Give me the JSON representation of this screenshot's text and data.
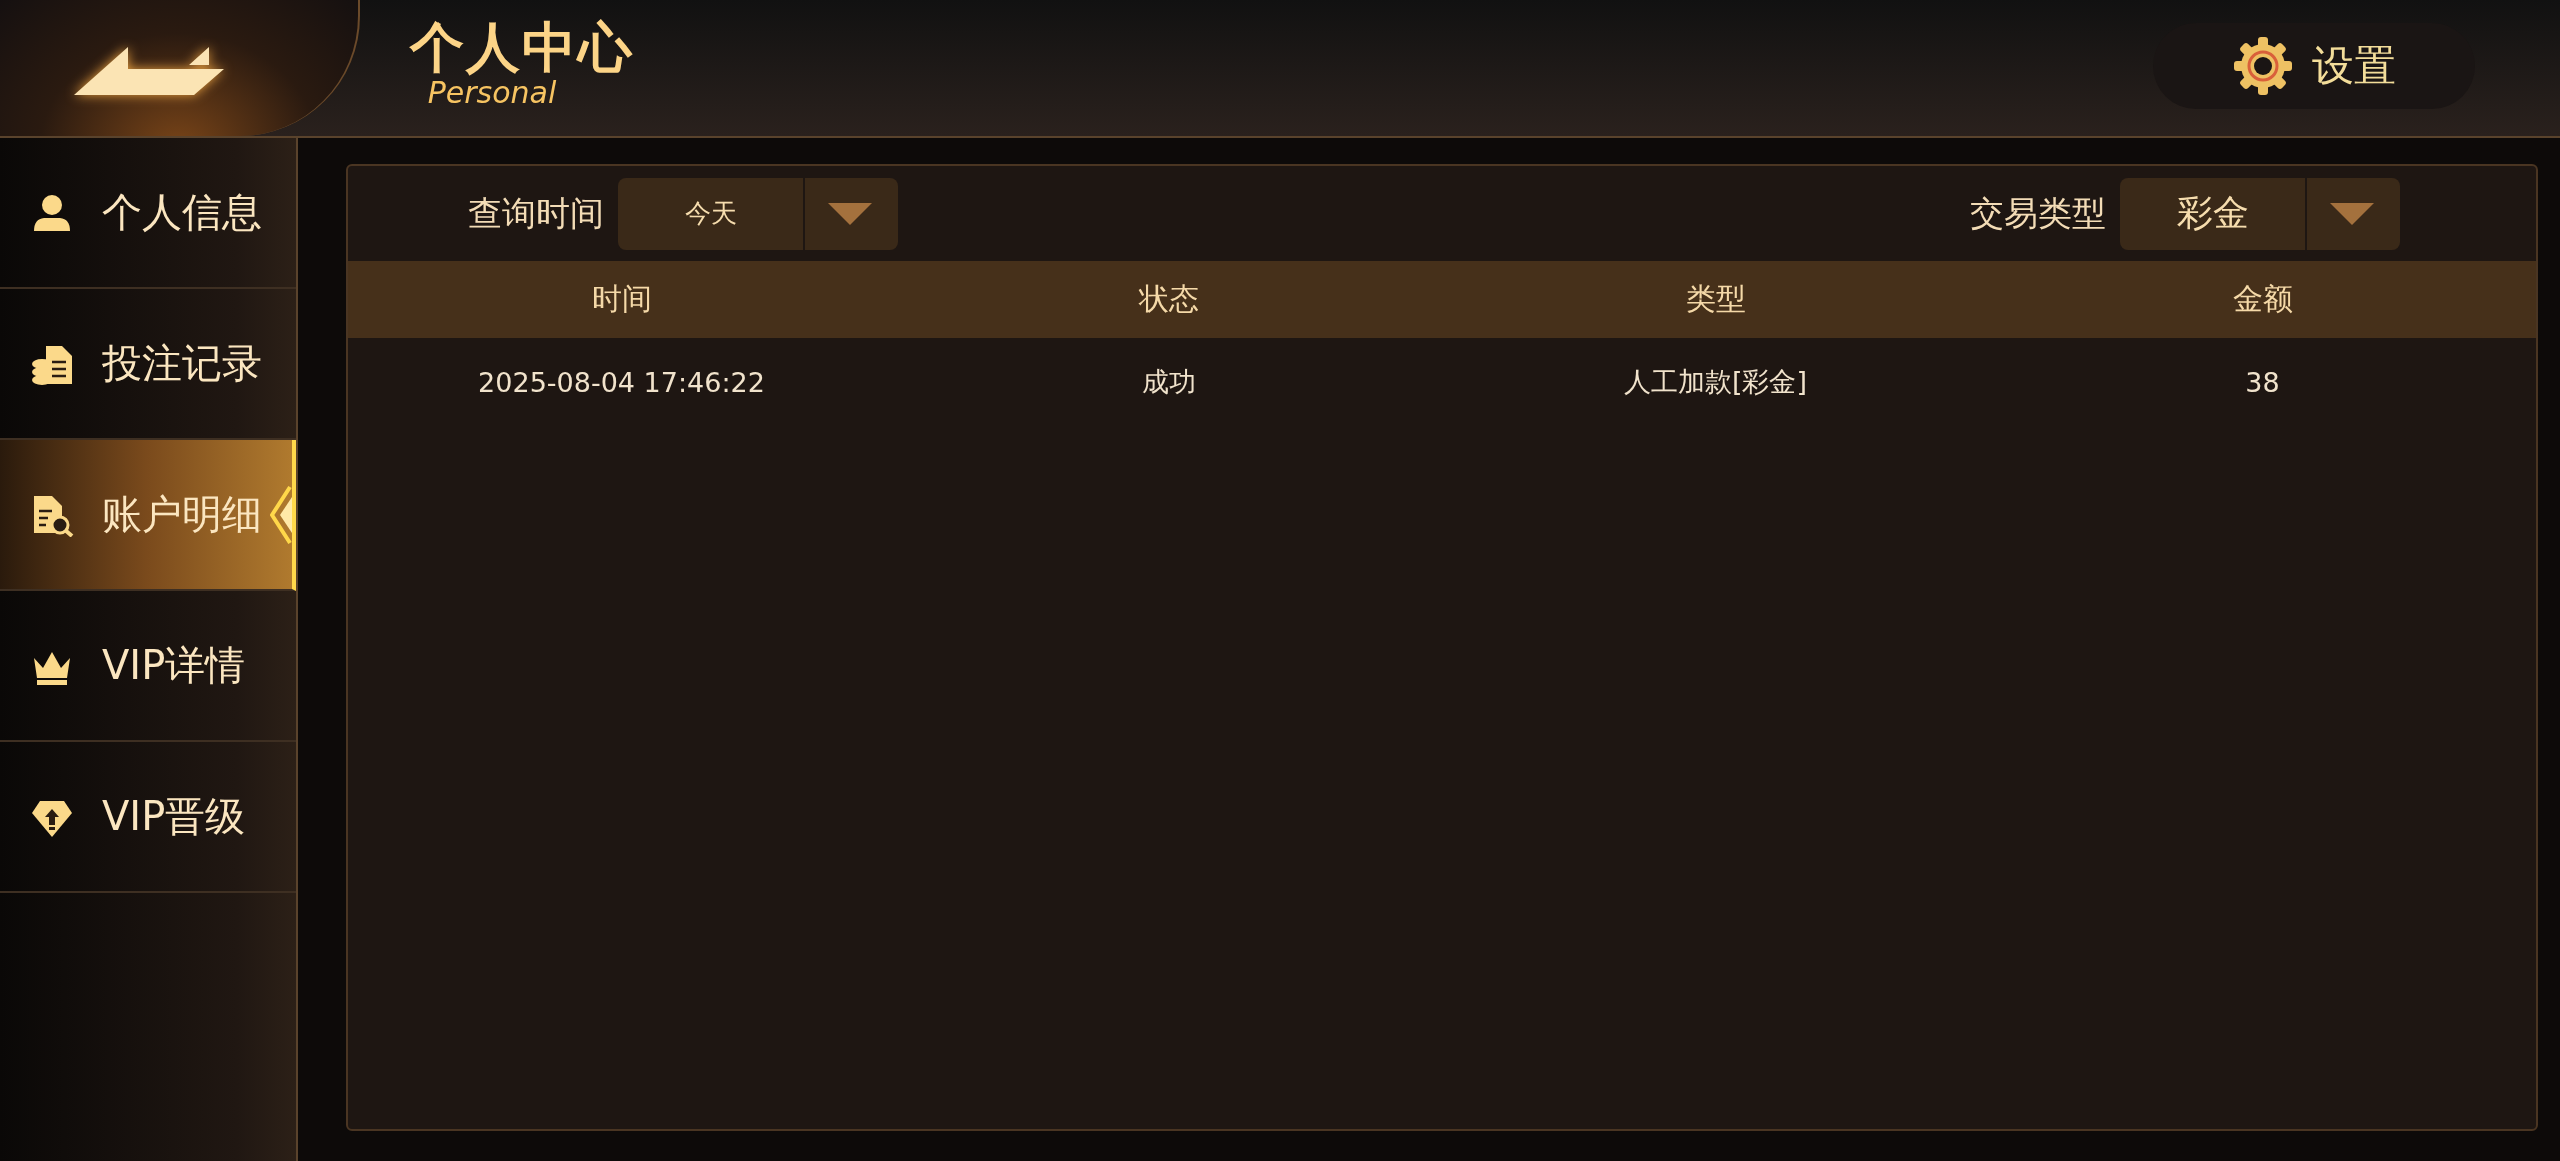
{
  "header": {
    "title": "个人中心",
    "subtitle": "Personal",
    "settings_label": "设置"
  },
  "sidebar": {
    "items": [
      {
        "label": "个人信息",
        "selected": false
      },
      {
        "label": "投注记录",
        "selected": false
      },
      {
        "label": "账户明细",
        "selected": true
      },
      {
        "label": "VIP详情",
        "selected": false
      },
      {
        "label": "VIP晋级",
        "selected": false
      }
    ]
  },
  "filters": [
    {
      "label": "查询时间",
      "value": "今天"
    },
    {
      "label": "交易类型",
      "value": "彩金"
    }
  ],
  "table": {
    "columns": [
      "时间",
      "状态",
      "类型",
      "金额"
    ],
    "rows": [
      [
        "2025-08-04 17:46:22",
        "成功",
        "人工加款[彩金]",
        "38"
      ]
    ]
  }
}
